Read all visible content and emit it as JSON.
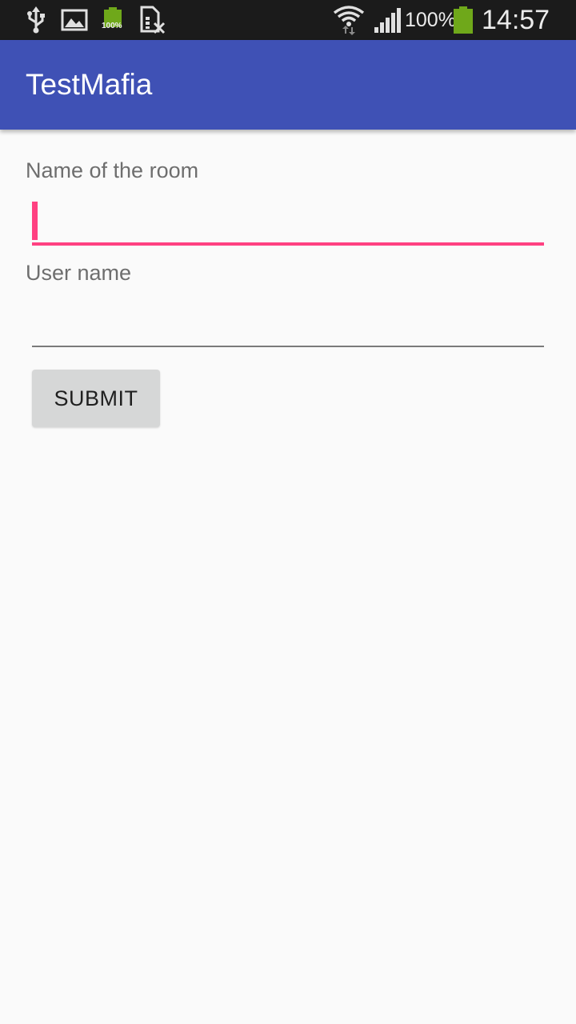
{
  "status_bar": {
    "notification_icons": [
      "usb-icon",
      "image-icon",
      "battery-full-notification-icon",
      "sim-card-off-icon"
    ],
    "battery_notification_text": "100%",
    "system_icons": [
      "wifi-icon",
      "signal-icon",
      "battery-icon"
    ],
    "battery_percent": "100%",
    "time": "14:57"
  },
  "app_bar": {
    "title": "TestMafia",
    "color": "#3f51b5"
  },
  "form": {
    "room_field": {
      "label": "Name of the room",
      "value": "",
      "focused": true
    },
    "user_field": {
      "label": "User name",
      "value": "",
      "focused": false
    },
    "submit_label": "SUBMIT"
  },
  "colors": {
    "accent": "#ff4081",
    "background": "#fafafa",
    "button": "#d6d7d7"
  }
}
